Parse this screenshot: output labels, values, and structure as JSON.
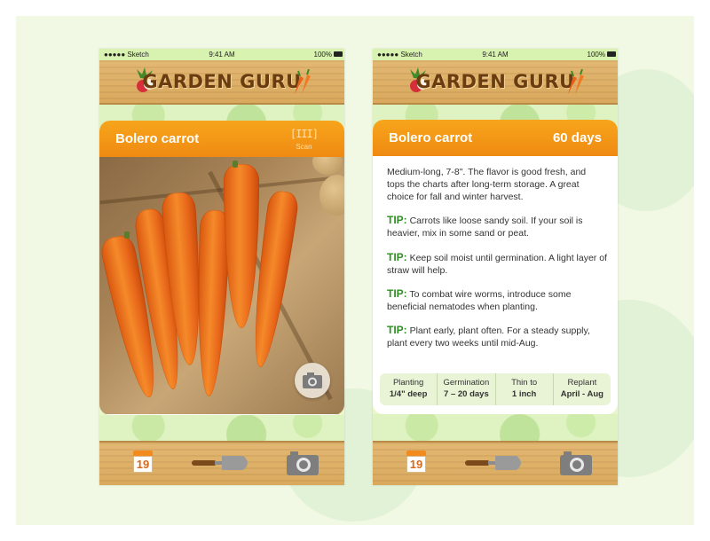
{
  "status_bar": {
    "carrier": "●●●●● Sketch",
    "time": "9:41 AM",
    "battery": "100%"
  },
  "app": {
    "title": "GARDEN GURU"
  },
  "scan_screen": {
    "card_title": "Bolero carrot",
    "scan_icon": "[III]",
    "scan_label": "Scan",
    "photo_icon": "camera-icon"
  },
  "detail_screen": {
    "card_title": "Bolero carrot",
    "days": "60 days",
    "description": "Medium-long, 7-8\". The flavor is good fresh, and tops the charts after long-term storage. A great choice for fall and winter harvest.",
    "tips": [
      {
        "label": "TIP:",
        "text": "Carrots like loose sandy soil. If your soil is heavier, mix in some sand or peat."
      },
      {
        "label": "TIP:",
        "text": "Keep soil moist until germination. A light layer of straw will help."
      },
      {
        "label": "TIP:",
        "text": "To combat wire worms, introduce some beneficial nematodes when planting."
      },
      {
        "label": "TIP:",
        "text": "Plant early, plant often. For a steady supply, plant every two weeks until mid-Aug."
      }
    ],
    "facts": [
      {
        "label": "Planting",
        "value": "1/4\" deep"
      },
      {
        "label": "Germination",
        "value": "7 – 20 days"
      },
      {
        "label": "Thin to",
        "value": "1 inch"
      },
      {
        "label": "Replant",
        "value": "April - Aug"
      }
    ]
  },
  "tab_bar": {
    "calendar_day": "19",
    "items": [
      "calendar-icon",
      "trowel-icon",
      "camera-icon"
    ]
  },
  "colors": {
    "orange_header": "#f39a1a",
    "tip_green": "#2f8f22",
    "wood": "#dcae66",
    "leaf_bg": "#e9f6c9"
  }
}
